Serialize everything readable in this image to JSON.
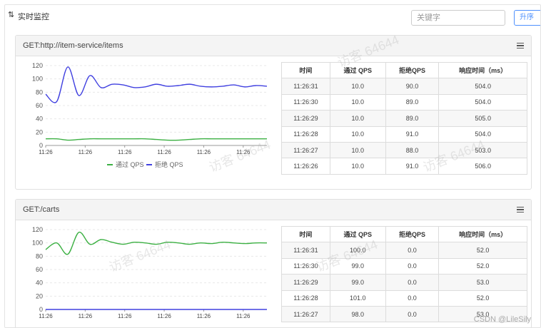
{
  "header": {
    "title": "实时监控",
    "search_placeholder": "关键字",
    "sort_label": "升序"
  },
  "watermark_text": "访客 64644",
  "footer_credit": "CSDN @LileSily",
  "panels": [
    {
      "title": "GET:http://item-service/items",
      "table": {
        "headers": [
          "时间",
          "通过 QPS",
          "拒绝QPS",
          "响应时间（ms）"
        ],
        "rows": [
          [
            "11:26:31",
            "10.0",
            "90.0",
            "504.0"
          ],
          [
            "11:26:30",
            "10.0",
            "89.0",
            "504.0"
          ],
          [
            "11:26:29",
            "10.0",
            "89.0",
            "505.0"
          ],
          [
            "11:26:28",
            "10.0",
            "91.0",
            "504.0"
          ],
          [
            "11:26:27",
            "10.0",
            "88.0",
            "503.0"
          ],
          [
            "11:26:26",
            "10.0",
            "91.0",
            "506.0"
          ]
        ]
      }
    },
    {
      "title": "GET:/carts",
      "table": {
        "headers": [
          "时间",
          "通过 QPS",
          "拒绝QPS",
          "响应时间（ms）"
        ],
        "rows": [
          [
            "11:26:31",
            "100.0",
            "0.0",
            "52.0"
          ],
          [
            "11:26:30",
            "99.0",
            "0.0",
            "52.0"
          ],
          [
            "11:26:29",
            "99.0",
            "0.0",
            "53.0"
          ],
          [
            "11:26:28",
            "101.0",
            "0.0",
            "52.0"
          ],
          [
            "11:26:27",
            "98.0",
            "0.0",
            "53.0"
          ]
        ]
      }
    }
  ],
  "chart_data": [
    {
      "type": "line",
      "x": [
        "11:26",
        "11:26",
        "11:26",
        "11:26",
        "11:26",
        "11:26"
      ],
      "yticks": [
        0,
        20,
        40,
        60,
        80,
        100,
        120
      ],
      "ylim": [
        0,
        120
      ],
      "legend_placement": "bottom",
      "series": [
        {
          "name": "通过 QPS",
          "color": "#3cb043",
          "values": [
            10,
            10,
            8,
            9,
            10,
            10,
            10,
            10,
            10,
            10,
            9,
            8,
            8,
            9,
            10,
            10,
            10,
            10,
            10,
            10,
            10
          ]
        },
        {
          "name": "拒绝 QPS",
          "color": "#4040e0",
          "values": [
            77,
            66,
            118,
            75,
            105,
            87,
            92,
            91,
            87,
            88,
            92,
            89,
            90,
            92,
            89,
            88,
            89,
            91,
            88,
            90,
            89
          ]
        }
      ]
    },
    {
      "type": "line",
      "x": [
        "11:26",
        "11:26",
        "11:26",
        "11:26",
        "11:26",
        "11:26"
      ],
      "yticks": [
        0,
        20,
        40,
        60,
        80,
        100,
        120
      ],
      "ylim": [
        0,
        120
      ],
      "series": [
        {
          "color": "#3cb043",
          "values": [
            90,
            100,
            83,
            116,
            98,
            105,
            101,
            98,
            101,
            100,
            98,
            101,
            100,
            98,
            100,
            99,
            101,
            100,
            99,
            100,
            100
          ]
        },
        {
          "color": "#4040e0",
          "values": [
            0,
            0,
            0,
            0,
            0,
            0,
            0,
            0,
            0,
            0,
            0,
            0,
            0,
            0,
            0,
            0,
            0,
            0,
            0,
            0,
            0
          ]
        }
      ]
    }
  ]
}
